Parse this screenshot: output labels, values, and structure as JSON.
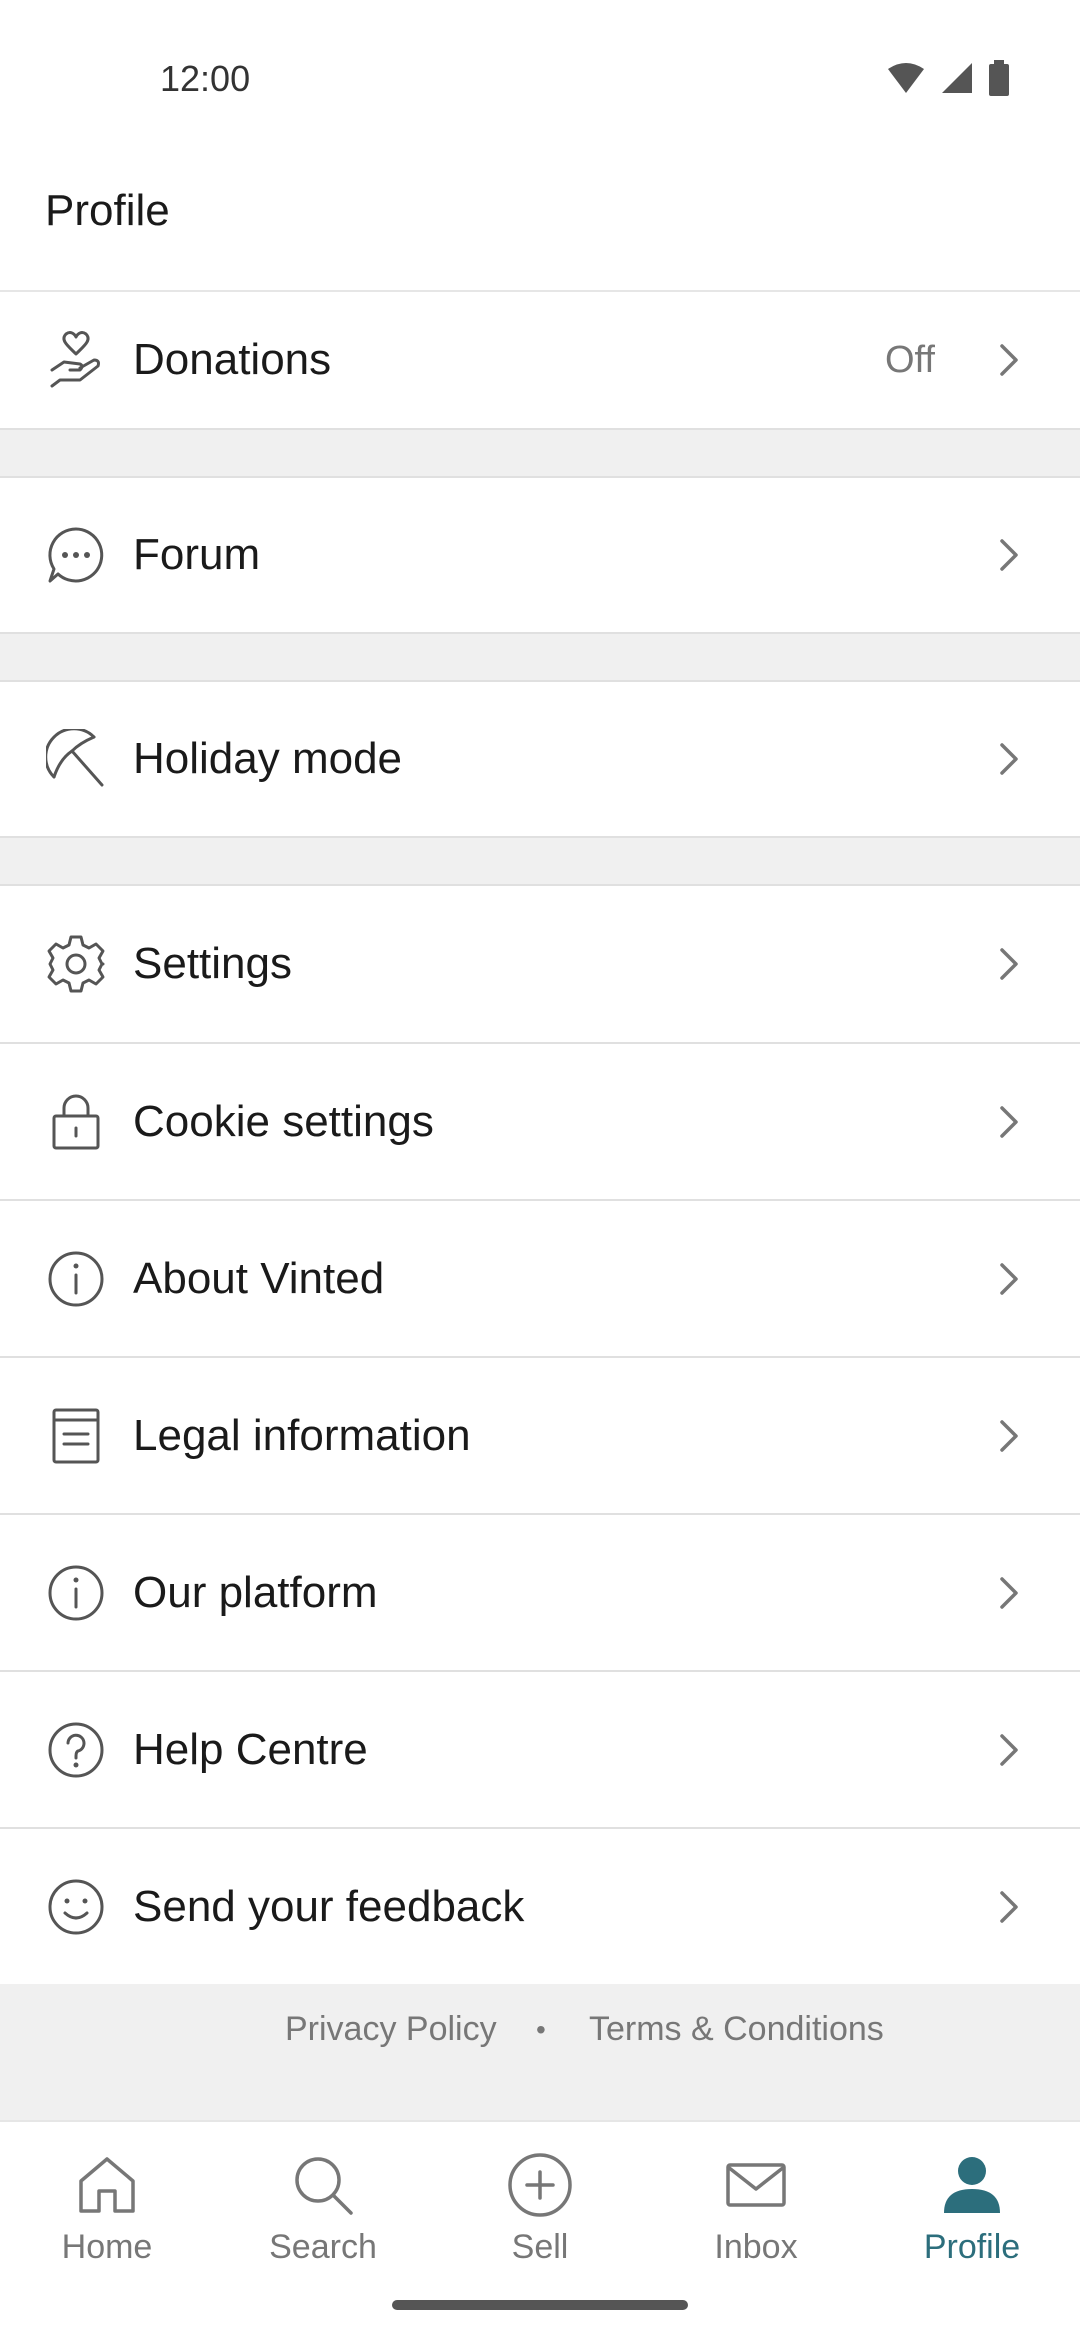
{
  "status_bar": {
    "time": "12:00"
  },
  "header": {
    "title": "Profile"
  },
  "rows": [
    {
      "label": "Donations",
      "value": "Off",
      "icon": "donation-heart-hand-icon"
    },
    {
      "label": "Forum",
      "icon": "chat-bubble-icon"
    },
    {
      "label": "Holiday mode",
      "icon": "umbrella-off-icon"
    },
    {
      "label": "Settings",
      "icon": "gear-icon"
    },
    {
      "label": "Cookie settings",
      "icon": "lock-icon"
    },
    {
      "label": "About Vinted",
      "icon": "info-icon"
    },
    {
      "label": "Legal information",
      "icon": "document-icon"
    },
    {
      "label": "Our platform",
      "icon": "info-icon"
    },
    {
      "label": "Help Centre",
      "icon": "question-icon"
    },
    {
      "label": "Send your feedback",
      "icon": "smiley-icon"
    }
  ],
  "footer": {
    "privacy": "Privacy Policy",
    "separator": "•",
    "terms": "Terms & Conditions"
  },
  "nav": [
    {
      "label": "Home",
      "icon": "home-icon"
    },
    {
      "label": "Search",
      "icon": "search-icon"
    },
    {
      "label": "Sell",
      "icon": "plus-circle-icon"
    },
    {
      "label": "Inbox",
      "icon": "mail-icon"
    },
    {
      "label": "Profile",
      "icon": "profile-icon",
      "active": true
    }
  ],
  "colors": {
    "accent": "#2c6e7c",
    "text": "#1a1a1a",
    "muted": "#777777",
    "divider": "#e0e0e0",
    "section_gap": "#f0f0f0"
  }
}
